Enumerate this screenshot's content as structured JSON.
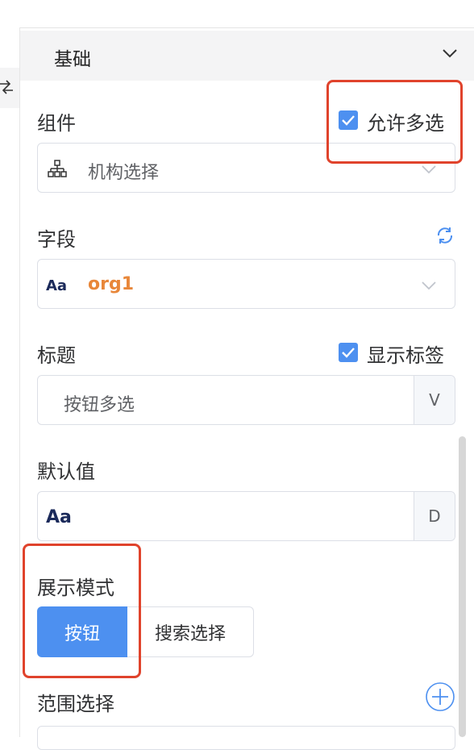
{
  "section": {
    "title": "基础"
  },
  "component": {
    "label": "组件",
    "allow_multi_label": "允许多选",
    "allow_multi_checked": true,
    "value": "机构选择",
    "icon": "org-tree-icon"
  },
  "field": {
    "label": "字段",
    "value": "org1",
    "type_icon_text": "Aa",
    "refresh_icon": "refresh-icon"
  },
  "title": {
    "label": "标题",
    "show_label_label": "显示标签",
    "show_label_checked": true,
    "value": "按钮多选",
    "suffix": "V"
  },
  "default_value": {
    "label": "默认值",
    "type_icon_text": "Aa",
    "suffix": "D"
  },
  "display_mode": {
    "label": "展示模式",
    "options": [
      "按钮",
      "搜索选择"
    ],
    "selected": "按钮"
  },
  "range": {
    "label": "范围选择",
    "add_icon": "plus-circle-icon"
  },
  "colors": {
    "accent": "#4d90f0",
    "highlight_box": "#e0432c",
    "field_value": "#e8873a"
  }
}
